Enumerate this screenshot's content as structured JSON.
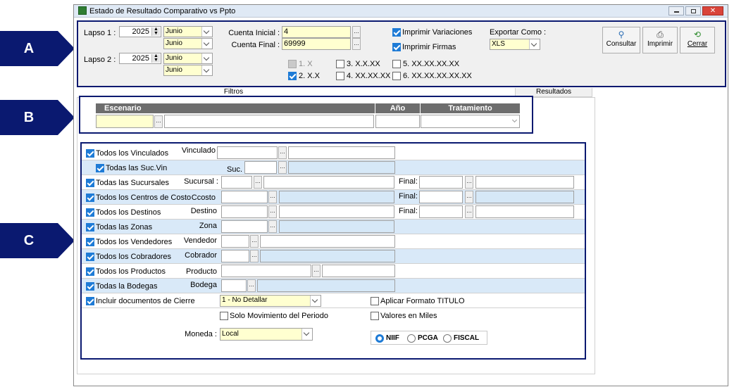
{
  "callouts": [
    "A",
    "B",
    "C"
  ],
  "window": {
    "title": "Estado de Resultado Comparativo vs Ppto"
  },
  "sectionA": {
    "lapso1_label": "Lapso 1 :",
    "lapso1_year": "2025",
    "lapso1_month_a": "Junio",
    "lapso1_month_b": "Junio",
    "lapso2_label": "Lapso 2 :",
    "lapso2_year": "2025",
    "lapso2_month_a": "Junio",
    "lapso2_month_b": "Junio",
    "cuenta_inicial_label": "Cuenta Inicial :",
    "cuenta_inicial_value": "4",
    "cuenta_final_label": "Cuenta Final :",
    "cuenta_final_value": "69999",
    "imprimir_variaciones": "Imprimir Variaciones",
    "imprimir_firmas": "Imprimir Firmas",
    "exportar_label": "Exportar Como :",
    "exportar_value": "XLS",
    "levels": [
      "1. X",
      "2. X.X",
      "3. X.X.XX",
      "4. XX.XX.XX",
      "5. XX.XX.XX.XX",
      "6. XX.XX.XX.XX.XX"
    ],
    "buttons": {
      "consultar": "Consultar",
      "imprimir": "Imprimir",
      "cerrar": "Cerrar"
    }
  },
  "tabs": {
    "filtros": "Filtros",
    "resultados": "Resultados"
  },
  "sectionB": {
    "col_escenario": "Escenario",
    "col_anio": "Año",
    "col_tratamiento": "Tratamiento"
  },
  "sectionC": {
    "rows": [
      {
        "check": "Todos los Vinculados",
        "field": "Vinculado"
      },
      {
        "check": "Todas las Suc.Vin",
        "field": "Suc."
      },
      {
        "check": "Todas las Sucursales",
        "field": "Sucursal :",
        "final": "Final:"
      },
      {
        "check": "Todos los Centros de Costo",
        "field": "Ccosto",
        "final": "Final:"
      },
      {
        "check": "Todos los Destinos",
        "field": "Destino",
        "final": "Final:"
      },
      {
        "check": "Todas las Zonas",
        "field": "Zona"
      },
      {
        "check": "Todos los Vendedores",
        "field": "Vendedor"
      },
      {
        "check": "Todos los Cobradores",
        "field": "Cobrador"
      },
      {
        "check": "Todos los Productos",
        "field": "Producto"
      },
      {
        "check": "Todas la Bodegas",
        "field": "Bodega"
      }
    ],
    "incluir_cierre": "Incluir documentos de Cierre",
    "detalle_value": "1 - No Detallar",
    "aplicar_formato": "Aplicar Formato TITULO",
    "solo_movimiento": "Solo Movimiento del Periodo",
    "valores_miles": "Valores en Miles",
    "moneda_label": "Moneda :",
    "moneda_value": "Local",
    "normas": [
      "NIIF",
      "PCGA",
      "FISCAL"
    ]
  }
}
